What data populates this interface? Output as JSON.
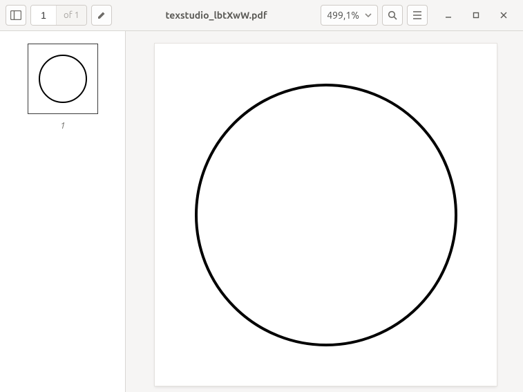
{
  "toolbar": {
    "page_current": "1",
    "page_of_prefix": "of",
    "page_total": "1",
    "title": "texstudio_lbtXwW.pdf",
    "zoom": "499,1%"
  },
  "sidebar": {
    "thumb_label": "1"
  }
}
